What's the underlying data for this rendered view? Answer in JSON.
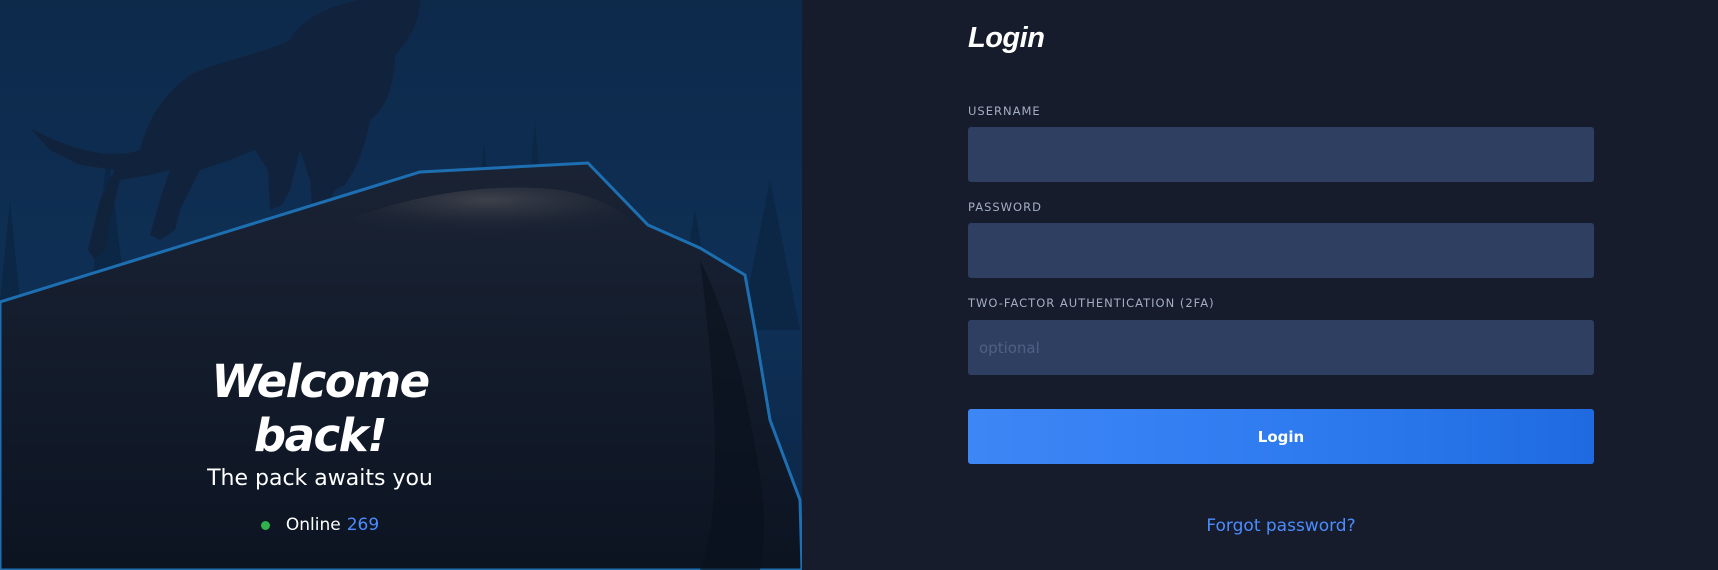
{
  "hero": {
    "title": "Welcome back!",
    "subtitle": "The pack awaits you",
    "online_label": "Online",
    "online_count": "269",
    "online_status_color": "#2fb24c"
  },
  "login_form": {
    "title": "Login",
    "username": {
      "label": "USERNAME",
      "value": "",
      "placeholder": ""
    },
    "password": {
      "label": "PASSWORD",
      "value": "",
      "placeholder": ""
    },
    "twofa": {
      "label": "TWO-FACTOR AUTHENTICATION (2FA)",
      "value": "",
      "placeholder": "optional"
    },
    "submit_label": "Login",
    "forgot_label": "Forgot password?"
  },
  "colors": {
    "accent": "#3d86f6",
    "link": "#4b8cff",
    "panel_bg": "#161c2b",
    "input_bg": "#2e3f62"
  }
}
